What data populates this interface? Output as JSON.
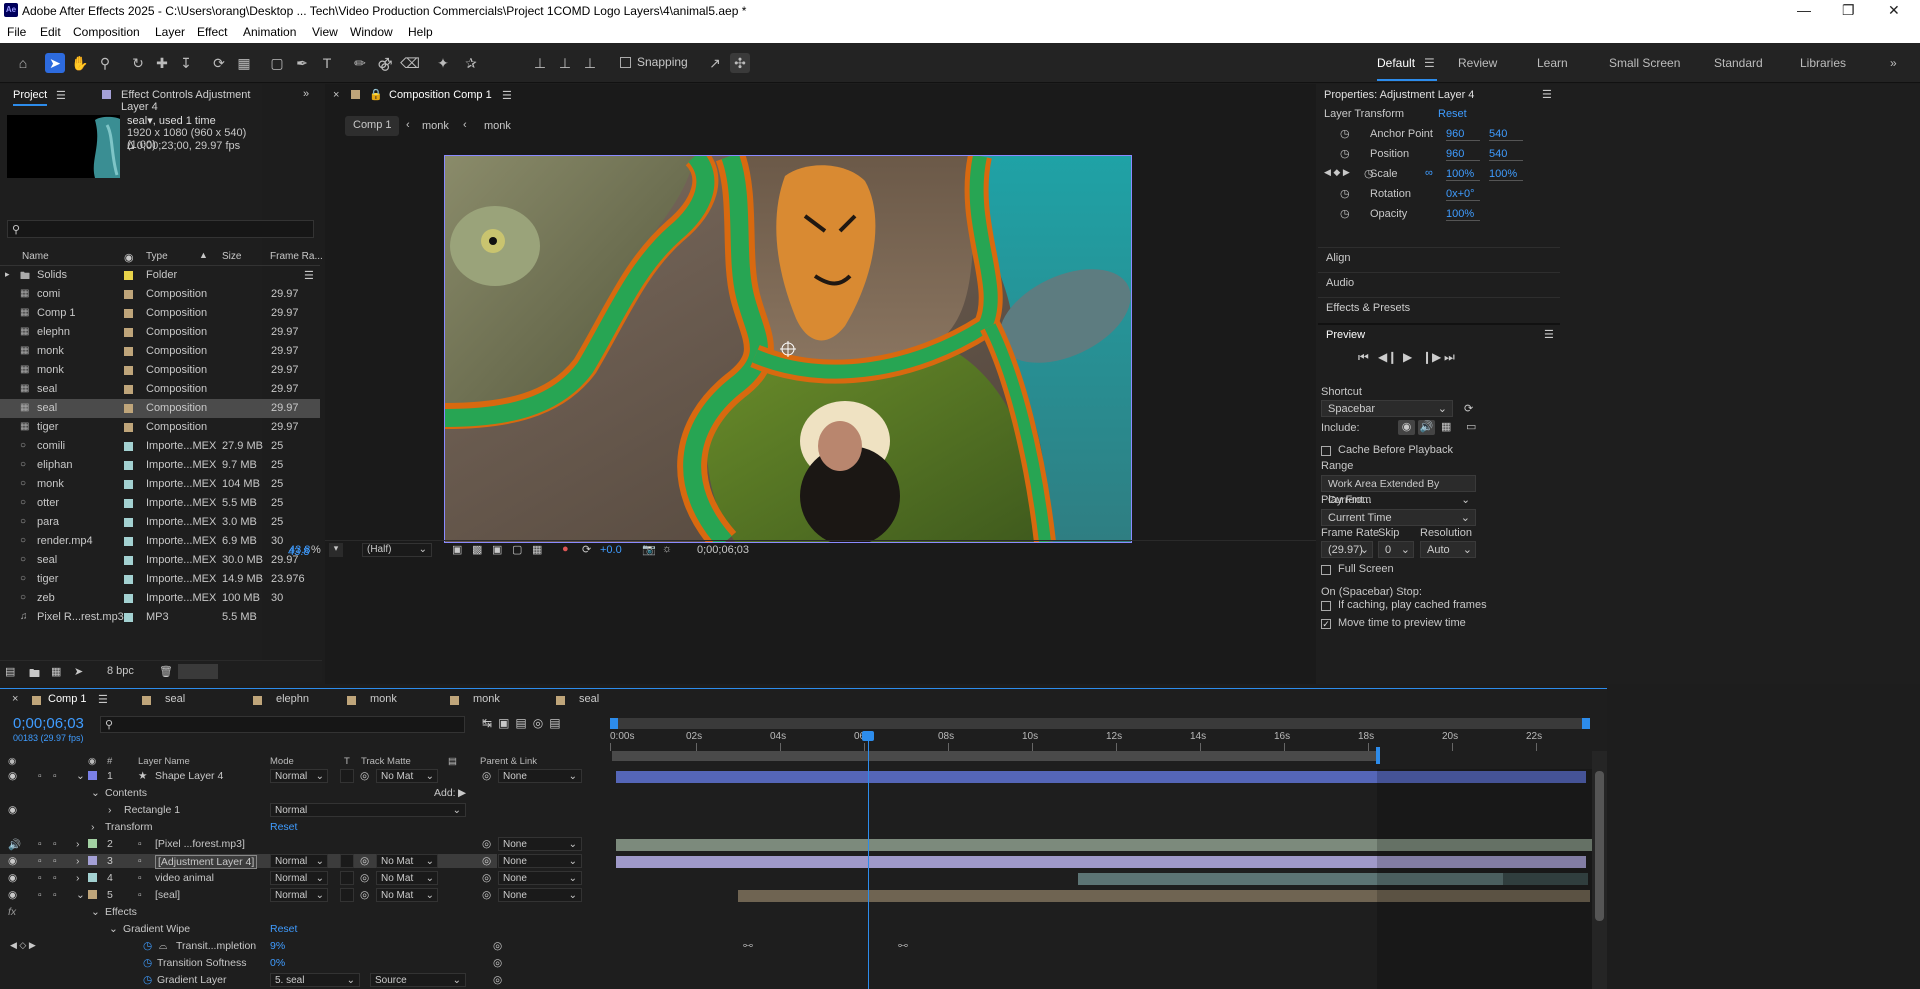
{
  "app": {
    "title": "Adobe After Effects 2025 - C:\\Users\\orang\\Desktop ... Tech\\Video Production Commercials\\Project 1COMD Logo Layers\\4\\animal5.aep *",
    "logo": "Ae",
    "window_controls": [
      "minimize-icon",
      "restore-icon",
      "close-icon"
    ]
  },
  "menu": [
    "File",
    "Edit",
    "Composition",
    "Layer",
    "Effect",
    "Animation",
    "View",
    "Window",
    "Help"
  ],
  "toolbar": {
    "snapping_label": "Snapping",
    "workspaces": [
      "Default",
      "Review",
      "Learn",
      "Small Screen",
      "Standard",
      "Libraries"
    ],
    "active_workspace": "Default"
  },
  "project_panel": {
    "tab_project": "Project",
    "tab_effect_controls": "Effect Controls Adjustment Layer 4",
    "selected_name": "seal",
    "used": ", used 1 time",
    "dims": "1920 x 1080  (960 x 540) (1.00)",
    "duration": "Δ 0;00;23;00, 29.97 fps",
    "search_placeholder": "",
    "columns": {
      "name": "Name",
      "type": "Type",
      "size": "Size",
      "frame_rate": "Frame Ra..."
    },
    "items": [
      {
        "name": "Solids",
        "type": "Folder",
        "size": "",
        "fr": "",
        "color": "#e8d34a",
        "kind": "folder"
      },
      {
        "name": "comi",
        "type": "Composition",
        "size": "",
        "fr": "29.97",
        "color": "#bfa57a",
        "kind": "comp"
      },
      {
        "name": "Comp 1",
        "type": "Composition",
        "size": "",
        "fr": "29.97",
        "color": "#bfa57a",
        "kind": "comp"
      },
      {
        "name": "elephn",
        "type": "Composition",
        "size": "",
        "fr": "29.97",
        "color": "#bfa57a",
        "kind": "comp"
      },
      {
        "name": "monk",
        "type": "Composition",
        "size": "",
        "fr": "29.97",
        "color": "#bfa57a",
        "kind": "comp"
      },
      {
        "name": "monk",
        "type": "Composition",
        "size": "",
        "fr": "29.97",
        "color": "#bfa57a",
        "kind": "comp"
      },
      {
        "name": "seal",
        "type": "Composition",
        "size": "",
        "fr": "29.97",
        "color": "#bfa57a",
        "kind": "comp"
      },
      {
        "name": "seal",
        "type": "Composition",
        "size": "",
        "fr": "29.97",
        "color": "#bfa57a",
        "kind": "comp",
        "selected": true
      },
      {
        "name": "tiger",
        "type": "Composition",
        "size": "",
        "fr": "29.97",
        "color": "#bfa57a",
        "kind": "comp"
      },
      {
        "name": "comili",
        "type": "Importe...MEX",
        "size": "27.9 MB",
        "fr": "25",
        "color": "#a3d1d1",
        "kind": "file"
      },
      {
        "name": "eliphan",
        "type": "Importe...MEX",
        "size": "9.7 MB",
        "fr": "25",
        "color": "#a3d1d1",
        "kind": "file"
      },
      {
        "name": "monk",
        "type": "Importe...MEX",
        "size": "104 MB",
        "fr": "25",
        "color": "#a3d1d1",
        "kind": "file"
      },
      {
        "name": "otter",
        "type": "Importe...MEX",
        "size": "5.5 MB",
        "fr": "25",
        "color": "#a3d1d1",
        "kind": "file"
      },
      {
        "name": "para",
        "type": "Importe...MEX",
        "size": "3.0 MB",
        "fr": "25",
        "color": "#a3d1d1",
        "kind": "file"
      },
      {
        "name": "render.mp4",
        "type": "Importe...MEX",
        "size": "6.9 MB",
        "fr": "30",
        "color": "#a3d1d1",
        "kind": "file"
      },
      {
        "name": "seal",
        "type": "Importe...MEX",
        "size": "30.0 MB",
        "fr": "29.97",
        "color": "#a3d1d1",
        "kind": "file"
      },
      {
        "name": "tiger",
        "type": "Importe...MEX",
        "size": "14.9 MB",
        "fr": "23.976",
        "color": "#a3d1d1",
        "kind": "file"
      },
      {
        "name": "zeb",
        "type": "Importe...MEX",
        "size": "100 MB",
        "fr": "30",
        "color": "#a3d1d1",
        "kind": "file"
      },
      {
        "name": "Pixel R...rest.mp3",
        "type": "MP3",
        "size": "5.5 MB",
        "fr": "",
        "color": "#a3d1d1",
        "kind": "audio"
      }
    ],
    "bpc": "8 bpc"
  },
  "comp_panel": {
    "tab": "Composition Comp 1",
    "breadcrumbs": [
      "Comp 1",
      "monk",
      "monk"
    ],
    "zoom": "43.8",
    "zoom_unit": "%",
    "resolution": "(Half)",
    "exposure": "+0.0",
    "timecode": "0;00;06;03"
  },
  "properties_panel": {
    "title": "Properties: Adjustment Layer 4",
    "section": "Layer Transform",
    "reset": "Reset",
    "props": [
      {
        "name": "Anchor Point",
        "v1": "960",
        "v2": "540"
      },
      {
        "name": "Position",
        "v1": "960",
        "v2": "540"
      },
      {
        "name": "Scale",
        "v1": "100%",
        "v2": "100%"
      },
      {
        "name": "Rotation",
        "v1": "0x+0°",
        "v2": ""
      },
      {
        "name": "Opacity",
        "v1": "100%",
        "v2": ""
      }
    ],
    "sections": [
      "Align",
      "Audio",
      "Effects & Presets"
    ],
    "preview": {
      "title": "Preview",
      "shortcut_label": "Shortcut",
      "shortcut": "Spacebar",
      "include_label": "Include:",
      "cache_before": "Cache Before Playback",
      "range_label": "Range",
      "range": "Work Area Extended By Current...",
      "play_from_label": "Play From",
      "play_from": "Current Time",
      "frame_rate_label": "Frame Rate",
      "skip_label": "Skip",
      "resolution_label": "Resolution",
      "frame_rate": "(29.97)",
      "skip": "0",
      "resolution": "Auto",
      "full_screen": "Full Screen",
      "stop_label": "On (Spacebar) Stop:",
      "if_caching": "If caching, play cached frames",
      "move_time": "Move time to preview time",
      "move_time_checked": true
    }
  },
  "timeline": {
    "tabs": [
      {
        "label": "Comp 1",
        "color": "#bfa57a",
        "active": true
      },
      {
        "label": "seal",
        "color": "#bfa57a"
      },
      {
        "label": "elephn",
        "color": "#bfa57a"
      },
      {
        "label": "monk",
        "color": "#bfa57a"
      },
      {
        "label": "monk",
        "color": "#bfa57a"
      },
      {
        "label": "seal",
        "color": "#bfa57a"
      }
    ],
    "timecode": "0;00;06;03",
    "frame_info": "00183 (29.97 fps)",
    "col_headers": {
      "num": "#",
      "layer_name": "Layer Name",
      "mode": "Mode",
      "t": "T",
      "track_matte": "Track Matte",
      "parent": "Parent & Link"
    },
    "ruler": [
      "0:00s",
      "02s",
      "04s",
      "06s",
      "08s",
      "10s",
      "12s",
      "14s",
      "16s",
      "18s",
      "20s",
      "22s"
    ],
    "rows": [
      {
        "num": "1",
        "name": "Shape Layer 4",
        "mode": "Normal",
        "matte": "No Mat",
        "parent": "None",
        "color": "#7a7fe6",
        "kind": "layer"
      },
      {
        "name": "Contents",
        "add": "Add:",
        "kind": "group"
      },
      {
        "name": "Rectangle 1",
        "mode": "Normal",
        "kind": "sub"
      },
      {
        "name": "Transform",
        "reset": "Reset",
        "kind": "group"
      },
      {
        "num": "2",
        "name": "[Pixel ...forest.mp3]",
        "parent": "None",
        "color": "#a3d1a3",
        "kind": "layer"
      },
      {
        "num": "3",
        "name": "[Adjustment Layer 4]",
        "mode": "Normal",
        "matte": "No Mat",
        "parent": "None",
        "color": "#a4a0d6",
        "kind": "layer",
        "selected": true
      },
      {
        "num": "4",
        "name": "video animal",
        "mode": "Normal",
        "matte": "No Mat",
        "parent": "None",
        "color": "#a3d1d1",
        "kind": "layer"
      },
      {
        "num": "5",
        "name": "[seal]",
        "mode": "Normal",
        "matte": "No Mat",
        "parent": "None",
        "color": "#bfa57a",
        "kind": "layer"
      },
      {
        "name": "Effects",
        "kind": "group"
      },
      {
        "name": "Gradient Wipe",
        "reset": "Reset",
        "kind": "effect"
      },
      {
        "name": "Transit...mpletion",
        "value": "9%",
        "kind": "param"
      },
      {
        "name": "Transition Softness",
        "value": "0%",
        "kind": "param"
      },
      {
        "name": "Gradient Layer",
        "value": "5. seal",
        "source": "Source",
        "kind": "param"
      }
    ]
  }
}
